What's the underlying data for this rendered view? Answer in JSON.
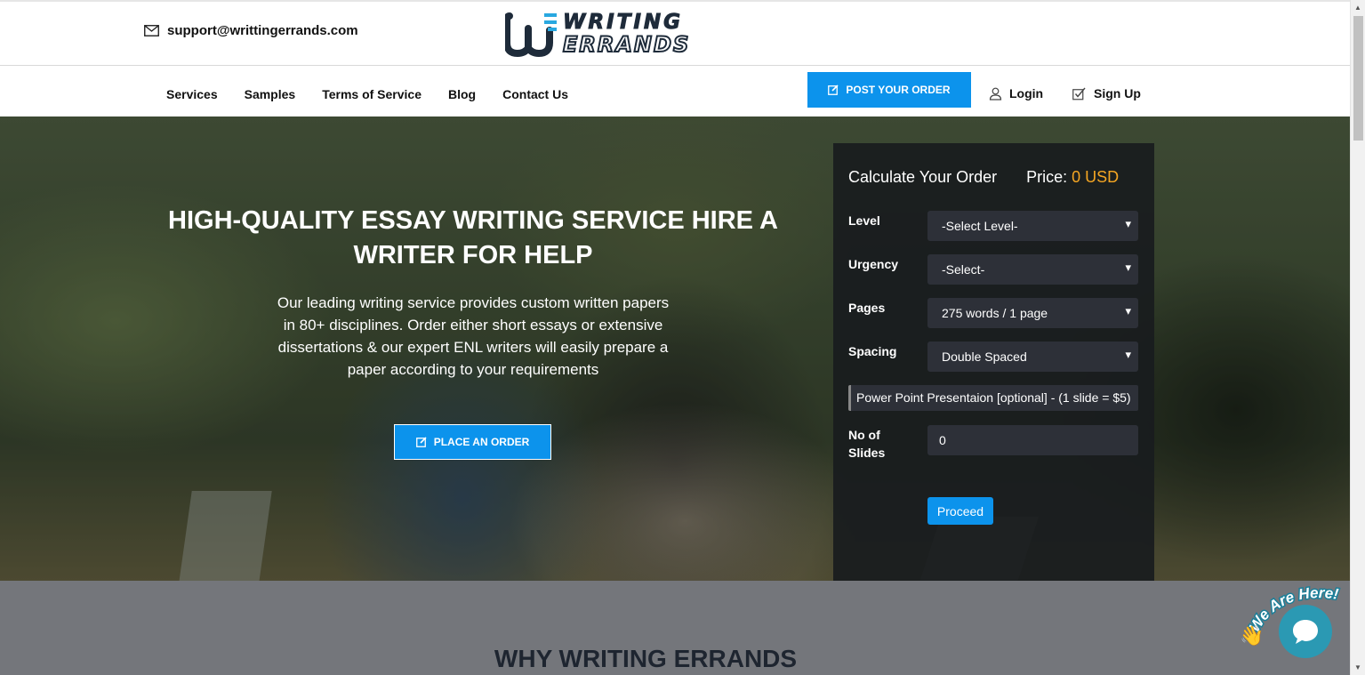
{
  "header": {
    "email": "support@writtingerrands.com",
    "logo_line1": "WRITING",
    "logo_line2": "ERRANDS"
  },
  "nav": {
    "links": [
      "Services",
      "Samples",
      "Terms of Service",
      "Blog",
      "Contact Us"
    ],
    "post_order_label": "POST YOUR ORDER",
    "login_label": "Login",
    "signup_label": "Sign Up"
  },
  "hero": {
    "title": "HIGH-QUALITY ESSAY WRITING SERVICE HIRE A WRITER FOR HELP",
    "text": "Our leading writing service provides custom written papers in 80+ disciplines. Order either short essays or extensive dissertations & our expert ENL writers will easily prepare a paper according to your requirements",
    "button_label": "PLACE AN ORDER"
  },
  "calculator": {
    "title": "Calculate Your Order",
    "price_label": "Price:",
    "price_value": "0 USD",
    "fields": [
      {
        "label": "Level",
        "value": "-Select Level-"
      },
      {
        "label": "Urgency",
        "value": "-Select-"
      },
      {
        "label": "Pages",
        "value": "275 words / 1 page"
      },
      {
        "label": "Spacing",
        "value": "Double Spaced"
      }
    ],
    "ppt_note": "Power Point Presentaion [optional] - (1 slide = $5)",
    "slides_label": "No of Slides",
    "slides_value": "0",
    "proceed_label": "Proceed"
  },
  "section": {
    "title": "WHY WRITING ERRANDS"
  },
  "chat": {
    "badge_text": "We Are Here!"
  },
  "colors": {
    "accent": "#0c93ec",
    "price": "#f5a623",
    "chat": "#2b99b3"
  }
}
